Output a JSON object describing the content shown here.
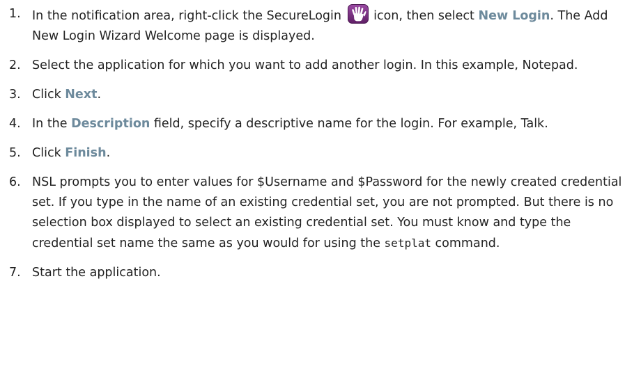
{
  "steps": [
    {
      "number": "1.",
      "t1": "In the notification area, right-click the SecureLogin ",
      "icon": "securelogin-hand-icon",
      "t2": " icon, then select ",
      "ui1": "New Login",
      "t3": ". The Add New Login Wizard Welcome page is displayed."
    },
    {
      "number": "2.",
      "t1": "Select the application for which you want to add another login. In this example, Notepad."
    },
    {
      "number": "3.",
      "t1": "Click ",
      "ui1": "Next",
      "t2": "."
    },
    {
      "number": "4.",
      "t1": "In the ",
      "ui1": "Description",
      "t2": " field, specify a descriptive name for the login. For example, Talk."
    },
    {
      "number": "5.",
      "t1": "Click ",
      "ui1": "Finish",
      "t2": "."
    },
    {
      "number": "6.",
      "t1": "NSL prompts you to enter values for $Username and $Password for the newly created credential set. If you type in the name of an existing credential set, you are not prompted. But there is no selection box displayed to select an existing credential set. You must know and type the credential set name the same as you would for using the ",
      "code": "setplat",
      "t2": " command."
    },
    {
      "number": "7.",
      "t1": "Start the application."
    }
  ],
  "colors": {
    "ui_label": "#6d8a9c",
    "icon_bg": "#7b2d82",
    "text": "#222222"
  }
}
